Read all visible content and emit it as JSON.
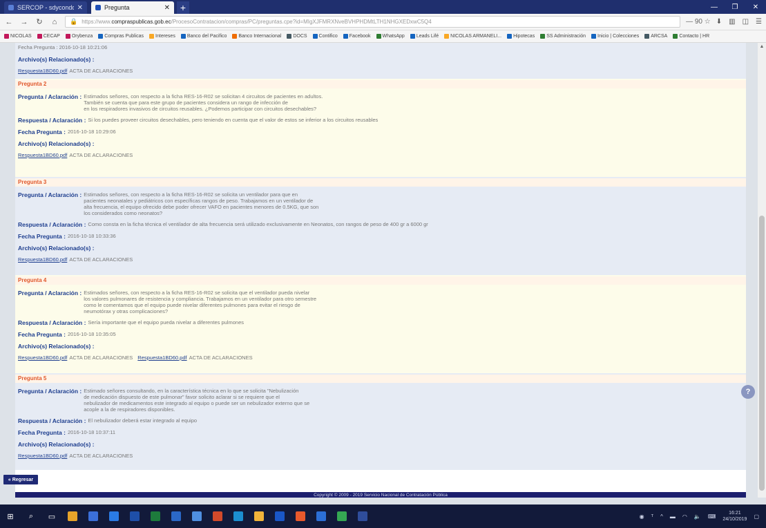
{
  "browser": {
    "tabs": [
      {
        "label": "SERCOP - sdyconddal - Ui"
      },
      {
        "label": "Pregunta"
      }
    ],
    "new_tab": "+",
    "window_controls": [
      "—",
      "❐",
      "✕"
    ],
    "url_domain": "compraspublicas.gob.ec",
    "url_prefix": "https://www.",
    "url_rest": "/ProcesoContratacion/compras/PC/preguntas.cpe?id=MIgXJFMRXNveBVHPHDMtLTH1NHGXEDxwC5Q4",
    "zoom": "— 90 ☆",
    "bookmarks": [
      {
        "label": "NICOLAS",
        "color": "#c2185b"
      },
      {
        "label": "CECAP",
        "color": "#c2185b"
      },
      {
        "label": "Orybenza",
        "color": "#c2185b"
      },
      {
        "label": "Compras Publicas",
        "color": "#1565c0"
      },
      {
        "label": "Intereses",
        "color": "#f9a825"
      },
      {
        "label": "Banco del Pacifico",
        "color": "#1565c0"
      },
      {
        "label": "Banco Internacional",
        "color": "#ef6c00"
      },
      {
        "label": "DOCS",
        "color": "#455a64"
      },
      {
        "label": "Contifico",
        "color": "#1565c0"
      },
      {
        "label": "Facebook",
        "color": "#1565c0"
      },
      {
        "label": "WhatsApp",
        "color": "#2e7d32"
      },
      {
        "label": "Leads Lifé",
        "color": "#1565c0"
      },
      {
        "label": "NICOLAS ARMANELI...",
        "color": "#f9a825"
      },
      {
        "label": "Hipotecas",
        "color": "#1565c0"
      },
      {
        "label": "SS Administración",
        "color": "#2e7d32"
      },
      {
        "label": "Inicio | Colecciones",
        "color": "#1565c0"
      },
      {
        "label": "ARCSA",
        "color": "#455a64"
      },
      {
        "label": "Contacto | HR",
        "color": "#2e7d32"
      }
    ]
  },
  "labels": {
    "pregunta": "Pregunta / Aclaración :",
    "respuesta": "Respuesta / Aclaración :",
    "fecha": "Fecha Pregunta :",
    "archivos": "Archivo(s) Relacionado(s) :",
    "back": "« Regresar"
  },
  "top_block": {
    "fecha_partial": "Fecha Pregunta : 2016-10-18 10:21:06",
    "file_link": "Respuesta1BD60.pdf",
    "file_desc": "ACTA DE ACLARACIONES"
  },
  "questions": [
    {
      "header": "Pregunta 2",
      "pregunta": "Estimados señores, con respecto a la ficha RES-16-R02 se solicitan 4 circuitos de pacientes en adultos.\nTambién se cuenta que para este grupo de pacientes considera un rango de infección de\nen los respiradores invasivos de circuitos reusables. ¿Podemos participar con circuitos desechables?",
      "respuesta": "Si los puedes proveer circuitos desechables, pero teniendo en cuenta que el valor de estos se inferior a los circuitos reusables",
      "fecha": "2016-10-18 10:29:06",
      "files": [
        {
          "link": "Respuesta1BD60.pdf",
          "desc": "ACTA DE ACLARACIONES"
        }
      ]
    },
    {
      "header": "Pregunta 3",
      "pregunta": "Estimados señores, con respecto a la ficha RES-16-R02 se solicita un ventilador para que en\npacientes neonatales y pediátricos con específicas rangos de peso. Trabajamos en un ventilador de\nalta frecuencia, el equipo ofrecido debe poder ofrecer VAFO en pacientes menores de 0.5KG, que son\nlos considerados como neonatos?",
      "respuesta": "Como consta en la ficha técnica el ventilador de alta frecuencia será utilizado exclusivamente en Neonatos, con rangos de peso de 400 gr a 6000 gr",
      "fecha": "2016-10-18 10:33:36",
      "files": [
        {
          "link": "Respuesta1BD60.pdf",
          "desc": "ACTA DE ACLARACIONES"
        }
      ]
    },
    {
      "header": "Pregunta 4",
      "pregunta": "Estimados señores, con respecto a la ficha RES-16-R02 se solicita que el ventilador pueda nivelar\nlos valores pulmonares de resistencia y compliancia. Trabajamos en un ventilador para otro semestre\ncomo le comentamos que el equipo puede nivelar diferentes pulmones para evitar el riesgo de\nneumotórax y otras complicaciones?",
      "respuesta": "Sería importante que el equipo pueda nivelar a diferentes pulmones",
      "fecha": "2016-10-18 10:35:05",
      "files": [
        {
          "link": "Respuesta1BD60.pdf",
          "desc": "ACTA DE ACLARACIONES"
        },
        {
          "link": "Respuesta1BD60.pdf",
          "desc": "ACTA DE ACLARACIONES"
        }
      ]
    },
    {
      "header": "Pregunta 5",
      "pregunta": "Estimado señores consultando, en la característica técnica en lo que se solicita \"Nebulización\nde medicación dispuesto de este pulmonar\" favor solicito aclarar si se requiere que el\nnebulizador de medicamentos este integrado al equipo o puede ser un nebulizador externo que se\nacople a la de respiradores disponibles.",
      "respuesta": "El nebulizador deberá estar integrado al equipo",
      "fecha": "2016-10-18 10:37:11",
      "files": [
        {
          "link": "Respuesta1BD60.pdf",
          "desc": "ACTA DE ACLARACIONES"
        }
      ]
    }
  ],
  "footer": "Copyright © 2009 - 2019 Servicio Nacional de Contratación Pública",
  "help": "?",
  "taskbar": {
    "time": "16:21",
    "date": "24/10/2019"
  }
}
